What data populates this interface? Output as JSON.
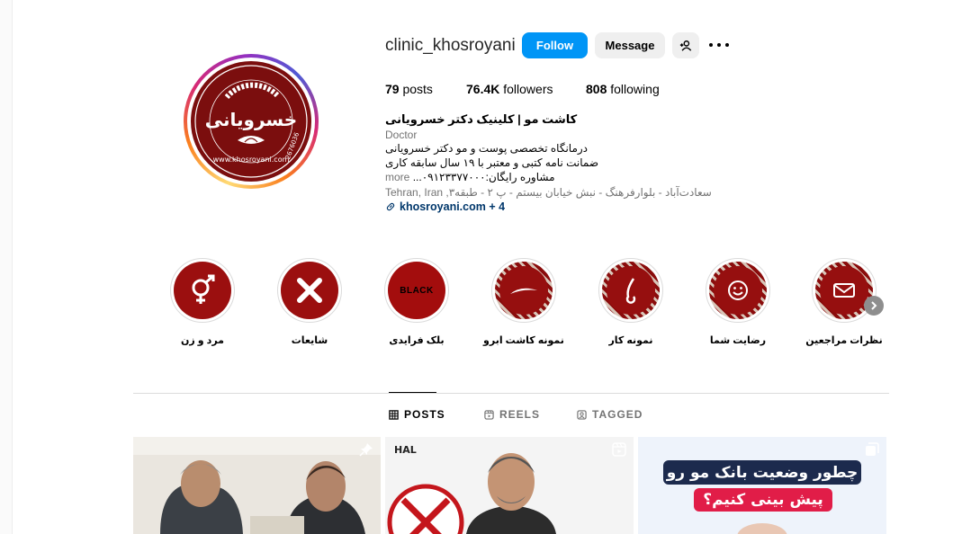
{
  "profile": {
    "username": "clinic_khosroyani",
    "follow_label": "Follow",
    "message_label": "Message",
    "posts_count": "79",
    "posts_label": "posts",
    "followers_count": "76.4K",
    "followers_label": "followers",
    "following_count": "808",
    "following_label": "following",
    "full_name": "کاشت مو | کلینیک دکتر خسرویانی",
    "category": "Doctor",
    "bio_lines": [
      "درمانگاه تخصصی پوست و مو دکتر خسرویانی",
      "ضمانت نامه کتبی و معتبر با ۱۹ سال سابقه کاری",
      "مشاوره رایگان:۰۹۱۲۳۳۷۷۰۰۰..."
    ],
    "more_label": "more",
    "address": "Tehran, Iran ,سعادت‌آباد - بلوارفرهنگ - نبش خیابان بیستم - پ ۲ - طبقه۳",
    "link": "khosroyani.com + 4",
    "avatar_text": "خسرویانی",
    "avatar_ring_text": "کلینیک تخصصی پوست ، مو و زیبایی",
    "avatar_site": "www.khosroyani.com",
    "avatar_phone": "2676036"
  },
  "highlights": [
    {
      "label": "مرد و زن",
      "icon": "gender-icon"
    },
    {
      "label": "شایعات",
      "icon": "x-mark-icon"
    },
    {
      "label": "بلک فرایدی",
      "icon": "black-friday-icon",
      "badge": "BLACK"
    },
    {
      "label": "نمونه کاشت ابرو",
      "icon": "eyebrow-icon"
    },
    {
      "label": "نمونه کار",
      "icon": "hair-strand-icon"
    },
    {
      "label": "رضایت شما",
      "icon": "smile-icon"
    },
    {
      "label": "نظرات مراجعین",
      "icon": "mail-icon"
    }
  ],
  "tabs": [
    {
      "label": "POSTS",
      "active": true
    },
    {
      "label": "REELS",
      "active": false
    },
    {
      "label": "TAGGED",
      "active": false
    }
  ],
  "posts": {
    "third_headline_1": "چطور وضعیت بانک مو رو",
    "third_headline_2": "پیش بینی کنیم؟",
    "second_logo": "HAL"
  },
  "colors": {
    "brand_red": "#9b0f0f",
    "accent_blue": "#0095f6",
    "link_blue": "#00376b"
  }
}
